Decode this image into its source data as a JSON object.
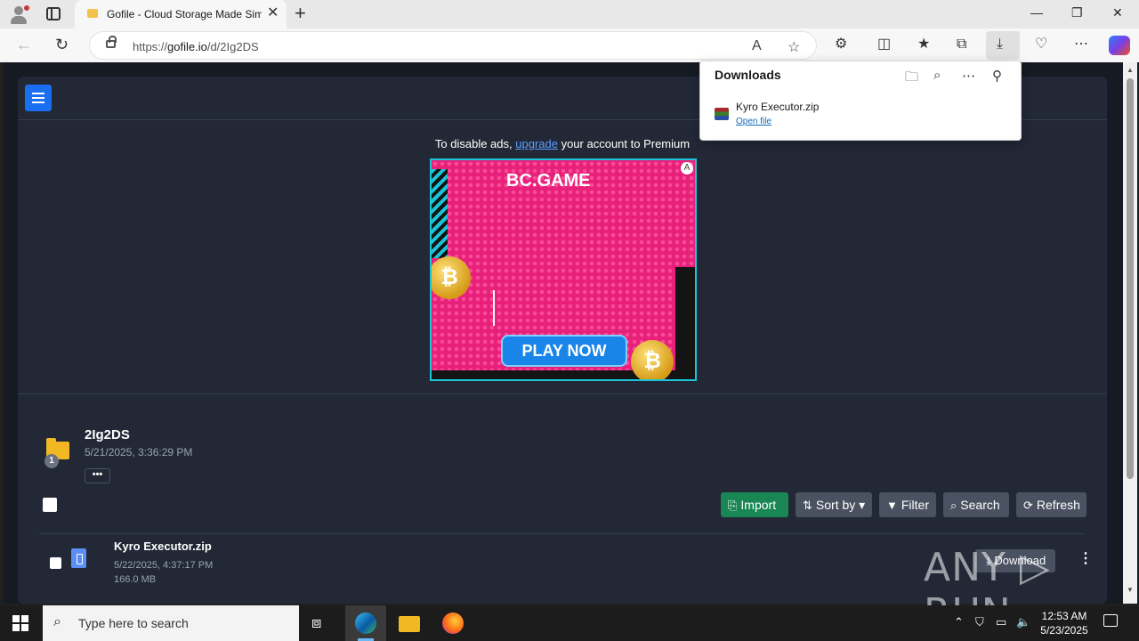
{
  "browser": {
    "tab_title": "Gofile - Cloud Storage Made Simple",
    "tab_close": "✕",
    "new_tab": "+",
    "url_prefix": "https://",
    "url_host": "gofile.io",
    "url_path": "/d/2Ig2DS",
    "window_controls": {
      "minimize": "—",
      "restore": "❐",
      "close": "✕"
    }
  },
  "downloads_panel": {
    "title": "Downloads",
    "item_name": "Kyro Executor.zip",
    "item_action": "Open file"
  },
  "page": {
    "ad_notice_before": "To disable ads, ",
    "ad_notice_link": "upgrade",
    "ad_notice_after": " your account to Premium",
    "ad": {
      "brand": "BC.GAME",
      "cta": "PLAY NOW",
      "coin_symbol": "₿"
    },
    "folder": {
      "name": "2Ig2DS",
      "date": "5/21/2025, 3:36:29 PM",
      "badge": "1",
      "more": "•••"
    },
    "actions": {
      "import": "Import",
      "sort_by": "Sort by",
      "filter": "Filter",
      "search": "Search",
      "refresh": "Refresh"
    },
    "files": [
      {
        "name": "Kyro Executor.zip",
        "date": "5/22/2025, 4:37:17 PM",
        "size": "166.0 MB",
        "download": "Download"
      }
    ]
  },
  "watermark": "ANY ▷ RUN",
  "taskbar": {
    "search_placeholder": "Type here to search",
    "time": "12:53 AM",
    "date": "5/23/2025"
  },
  "colors": {
    "accent_blue": "#1a6ff0",
    "import_green": "#198754",
    "page_bg": "#222836",
    "link": "#5aa0ff"
  }
}
